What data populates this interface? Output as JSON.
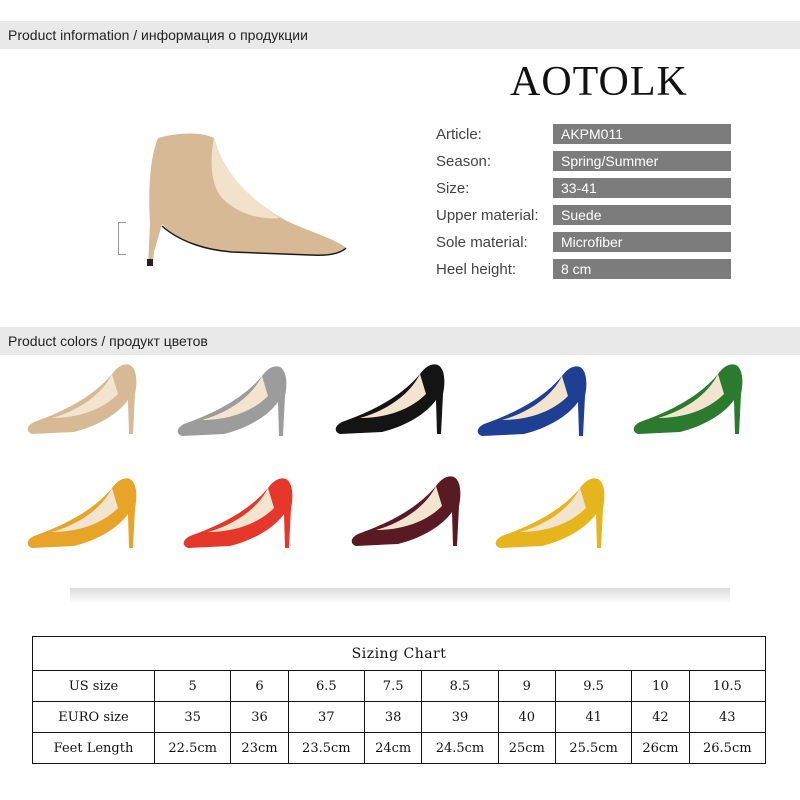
{
  "sections": {
    "info": "Product information / информация о продукции",
    "colors": "Product colors / продукт цветов"
  },
  "brand": "AOTOLK",
  "specs": [
    {
      "label": "Article:",
      "value": "AKPM011"
    },
    {
      "label": "Season:",
      "value": "Spring/Summer"
    },
    {
      "label": "Size:",
      "value": "33-41"
    },
    {
      "label": "Upper material:",
      "value": "Suede"
    },
    {
      "label": "Sole material:",
      "value": "Microfiber"
    },
    {
      "label": "Heel height:",
      "value": "8 cm"
    }
  ],
  "colors": {
    "beige": "#d7b995",
    "gray": "#9c9c9c",
    "black": "#141414",
    "blue": "#1f3f93",
    "green": "#2c7a2e",
    "orange": "#e7a429",
    "red": "#e5372a",
    "wine": "#5a1a24",
    "yellow": "#e6b41d"
  },
  "sizing_chart": {
    "title": "Sizing Chart",
    "rows": [
      {
        "label": "US size",
        "values": [
          "5",
          "6",
          "6.5",
          "7.5",
          "8.5",
          "9",
          "9.5",
          "10",
          "10.5"
        ]
      },
      {
        "label": "EURO size",
        "values": [
          "35",
          "36",
          "37",
          "38",
          "39",
          "40",
          "41",
          "42",
          "43"
        ]
      },
      {
        "label": "Feet Length",
        "values": [
          "22.5cm",
          "23cm",
          "23.5cm",
          "24cm",
          "24.5cm",
          "25cm",
          "25.5cm",
          "26cm",
          "26.5cm"
        ]
      }
    ]
  }
}
